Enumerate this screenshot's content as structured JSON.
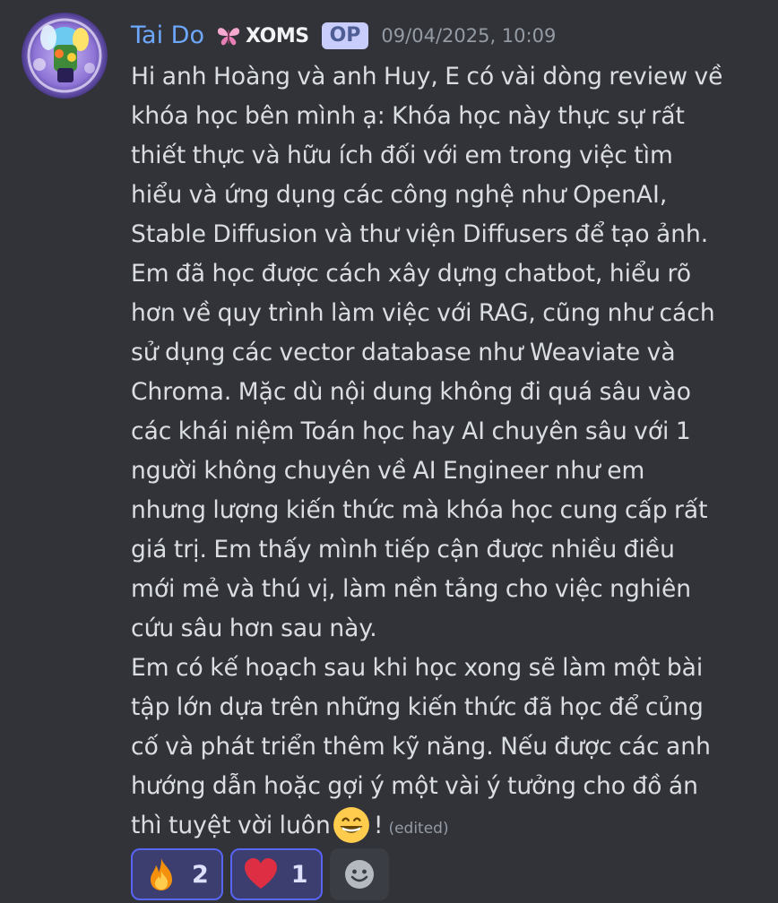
{
  "author": {
    "name": "Tai Do",
    "clan_tag": "XOMS",
    "clan_icon": "butterfly-icon",
    "op_badge": "OP",
    "timestamp": "09/04/2025, 10:09",
    "avatar": "avatar-image"
  },
  "message": {
    "lines": [
      "Hi anh Hoàng và anh Huy, E có vài dòng review về",
      "khóa học bên mình ạ:  Khóa học này thực sự rất",
      "thiết thực và hữu ích đối với em trong việc tìm",
      "hiểu và ứng dụng các công nghệ như OpenAI,",
      "Stable Diffusion và thư viện Diffusers để tạo ảnh.",
      "Em đã học được cách xây dựng chatbot, hiểu rõ",
      "hơn về quy trình làm việc với RAG, cũng như cách",
      "sử dụng các vector database như Weaviate và",
      "Chroma. Mặc dù nội dung không đi quá sâu vào",
      "các khái niệm Toán học hay AI chuyên sâu với 1",
      "người không chuyên về AI Engineer như em",
      "nhưng lượng kiến thức mà khóa học cung cấp rất",
      "giá trị. Em thấy mình tiếp cận được nhiều điều",
      "mới mẻ và thú vị, làm nền tảng cho việc nghiên",
      "cứu sâu hơn sau này.",
      "Em có kế hoạch sau khi học xong sẽ làm một bài",
      "tập lớn dựa trên những kiến thức đã học để củng",
      "cố và phát triển thêm kỹ năng. Nếu được các anh",
      "hướng dẫn hoặc gợi ý một vài ý tưởng cho đồ án"
    ],
    "last_line_text": "thì tuyệt vời luôn",
    "last_line_emoji": "grinning-face-emoji",
    "last_line_suffix": "!",
    "edited_label": "(edited)"
  },
  "reactions": [
    {
      "emoji": "fire-emoji",
      "count": "2"
    },
    {
      "emoji": "red-heart-emoji",
      "count": "1"
    }
  ],
  "add_reaction_icon": "add-reaction-smiley-icon",
  "colors": {
    "background": "#313338",
    "username": "#6ea8fe",
    "text": "#dbdee1",
    "muted": "#949ba4",
    "reaction_bg": "#3b3e6e",
    "reaction_border": "#5865f2",
    "op_badge_bg": "#c9cdfb"
  }
}
